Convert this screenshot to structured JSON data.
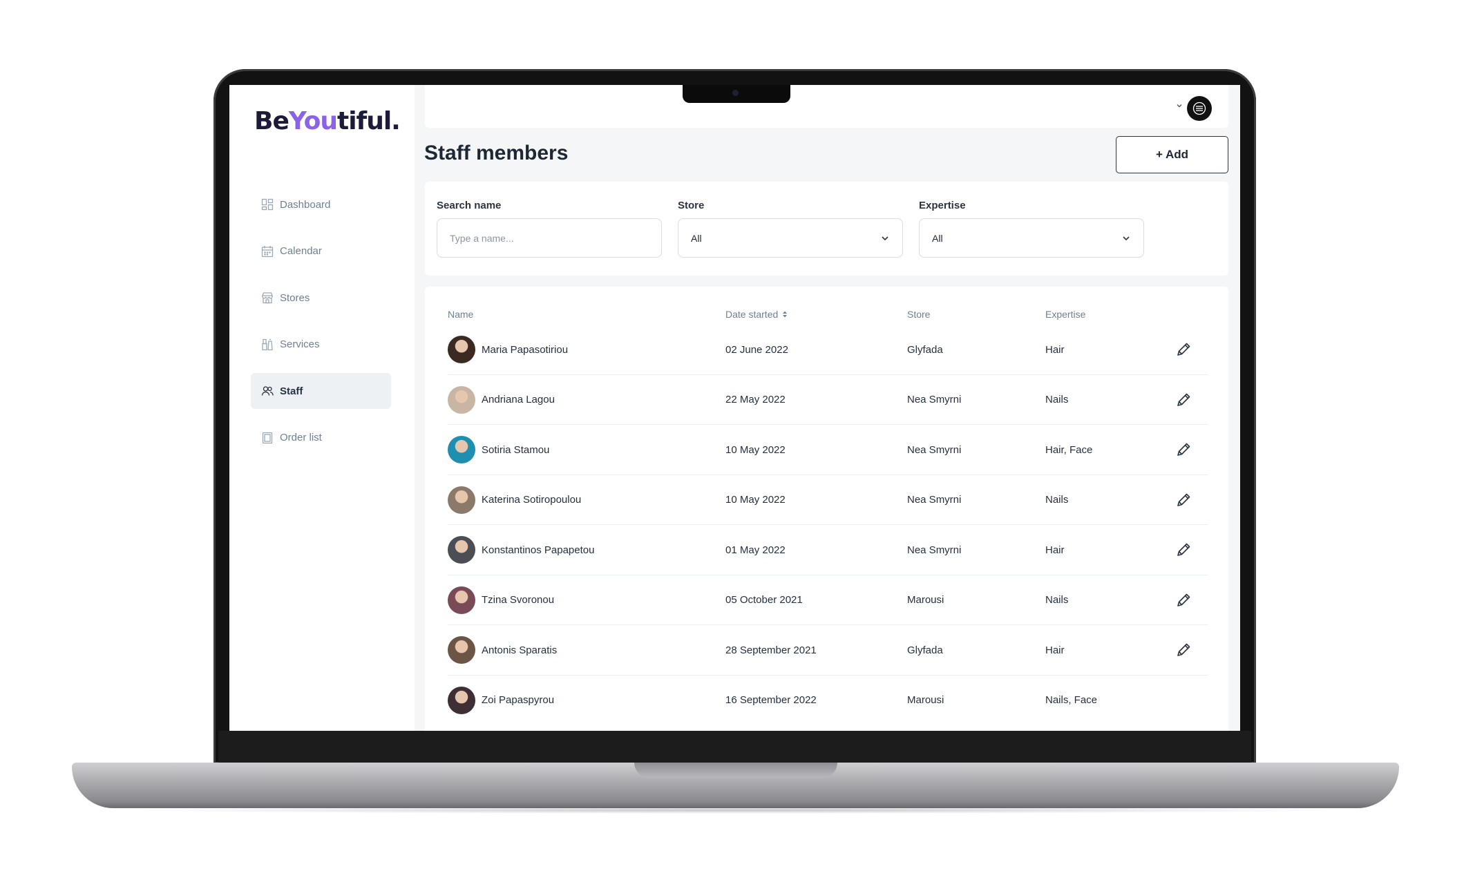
{
  "app": {
    "logo": {
      "part1": "Be",
      "part2": "You",
      "part3": "tiful."
    },
    "accent_color": "#8a63e8"
  },
  "sidebar": {
    "items": [
      {
        "label": "Dashboard",
        "icon": "dashboard-icon",
        "active": false
      },
      {
        "label": "Calendar",
        "icon": "calendar-icon",
        "active": false
      },
      {
        "label": "Stores",
        "icon": "store-icon",
        "active": false
      },
      {
        "label": "Services",
        "icon": "services-icon",
        "active": false
      },
      {
        "label": "Staff",
        "icon": "users-icon",
        "active": true
      },
      {
        "label": "Order list",
        "icon": "order-list-icon",
        "active": false
      }
    ]
  },
  "header": {
    "title": "Staff members",
    "add_label": "+ Add"
  },
  "filters": {
    "search": {
      "label": "Search name",
      "placeholder": "Type a name...",
      "value": ""
    },
    "store": {
      "label": "Store",
      "value": "All"
    },
    "expertise": {
      "label": "Expertise",
      "value": "All"
    }
  },
  "table": {
    "columns": [
      "Name",
      "Date started",
      "Store",
      "Expertise"
    ],
    "rows": [
      {
        "name": "Maria Papasotiriou",
        "date": "02 June 2022",
        "store": "Glyfada",
        "expertise": "Hair",
        "avatar_color": "#3b2a22"
      },
      {
        "name": "Andriana Lagou",
        "date": "22 May 2022",
        "store": "Nea Smyrni",
        "expertise": "Nails",
        "avatar_color": "#c9b5a3"
      },
      {
        "name": "Sotiria Stamou",
        "date": "10 May 2022",
        "store": "Nea Smyrni",
        "expertise": "Hair, Face",
        "avatar_color": "#1f8fb0"
      },
      {
        "name": "Katerina Sotiropoulou",
        "date": "10 May 2022",
        "store": "Nea Smyrni",
        "expertise": "Nails",
        "avatar_color": "#8b7a6a"
      },
      {
        "name": "Konstantinos Papapetou",
        "date": "01 May 2022",
        "store": "Nea Smyrni",
        "expertise": "Hair",
        "avatar_color": "#4b4f55"
      },
      {
        "name": "Tzina Svoronou",
        "date": "05 October 2021",
        "store": "Marousi",
        "expertise": "Nails",
        "avatar_color": "#7a4b57"
      },
      {
        "name": "Antonis Sparatis",
        "date": "28 September 2021",
        "store": "Glyfada",
        "expertise": "Hair",
        "avatar_color": "#6d5545"
      },
      {
        "name": "Zoi Papaspyrou",
        "date": "16 September 2022",
        "store": "Marousi",
        "expertise": "Nails, Face",
        "avatar_color": "#3e2f36"
      }
    ]
  }
}
